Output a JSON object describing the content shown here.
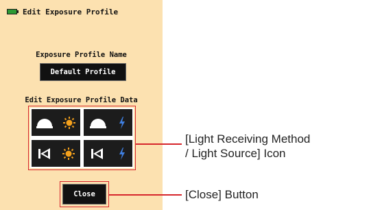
{
  "screen": {
    "title": "Edit Exposure Profile",
    "battery_icon": "battery-icon",
    "profile_name_label": "Exposure Profile Name",
    "profile_name_value": "Default Profile",
    "profile_data_label": "Edit Exposure Profile Data",
    "icon_grid": [
      {
        "method": "dome-icon",
        "source": "sun-icon"
      },
      {
        "method": "dome-icon",
        "source": "flash-icon"
      },
      {
        "method": "flat-icon",
        "source": "sun-icon"
      },
      {
        "method": "flat-icon",
        "source": "flash-icon"
      }
    ],
    "close_label": "Close"
  },
  "callouts": {
    "icon_grid_line1": "[Light Receiving Method",
    "icon_grid_line2": "/ Light Source] Icon",
    "close_button": "[Close] Button"
  },
  "colors": {
    "screen_bg": "#fce1b0",
    "button_bg": "#111111",
    "highlight": "#d6252b",
    "sun": "#f4a11d",
    "flash": "#3f7fe0",
    "battery": "#2d9a34"
  }
}
